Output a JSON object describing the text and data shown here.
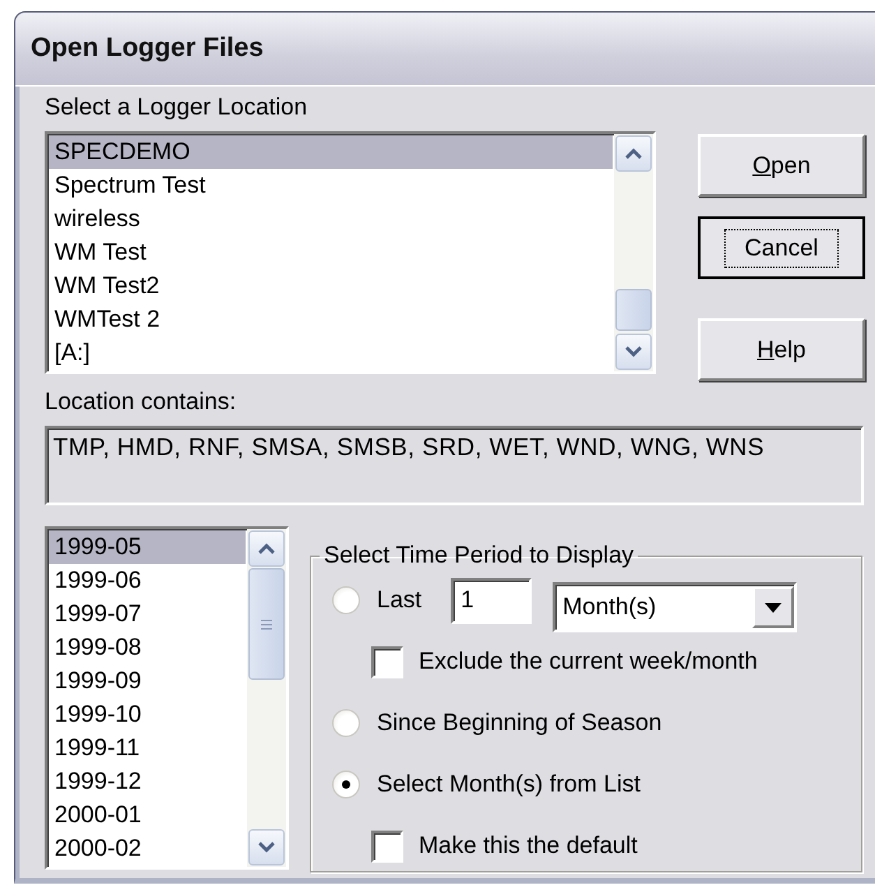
{
  "window": {
    "title": "Open Logger Files"
  },
  "location_label": "Select a Logger Location",
  "locations": [
    {
      "label": "SPECDEMO",
      "selected": true
    },
    {
      "label": "Spectrum Test",
      "selected": false
    },
    {
      "label": "wireless",
      "selected": false
    },
    {
      "label": "WM Test",
      "selected": false
    },
    {
      "label": "WM Test2",
      "selected": false
    },
    {
      "label": "WMTest 2",
      "selected": false
    },
    {
      "label": "[A:]",
      "selected": false
    }
  ],
  "buttons": [
    {
      "label": "Open",
      "default": false,
      "underline_first": true
    },
    {
      "label": "Cancel",
      "default": true,
      "underline_first": false
    },
    {
      "label": "Help",
      "default": false,
      "underline_first": true
    }
  ],
  "contains_label": "Location contains:",
  "contains_value": "TMP, HMD, RNF, SMSA, SMSB, SRD, WET, WND, WNG, WNS",
  "months": [
    {
      "label": "1999-05",
      "selected": true
    },
    {
      "label": "1999-06",
      "selected": false
    },
    {
      "label": "1999-07",
      "selected": false
    },
    {
      "label": "1999-08",
      "selected": false
    },
    {
      "label": "1999-09",
      "selected": false
    },
    {
      "label": "1999-10",
      "selected": false
    },
    {
      "label": "1999-11",
      "selected": false
    },
    {
      "label": "1999-12",
      "selected": false
    },
    {
      "label": "2000-01",
      "selected": false
    },
    {
      "label": "2000-02",
      "selected": false
    }
  ],
  "time_period": {
    "title": "Select Time Period to Display",
    "options": [
      {
        "kind": "radio",
        "label": "Last",
        "selected": false,
        "count": "1",
        "unit": "Month(s)"
      },
      {
        "kind": "checkbox",
        "label": "Exclude the current week/month",
        "checked": false
      },
      {
        "kind": "radio",
        "label": "Since Beginning of Season",
        "selected": false
      },
      {
        "kind": "radio",
        "label": "Select Month(s) from List",
        "selected": true
      },
      {
        "kind": "checkbox",
        "label": "Make this the default",
        "checked": false
      }
    ]
  }
}
